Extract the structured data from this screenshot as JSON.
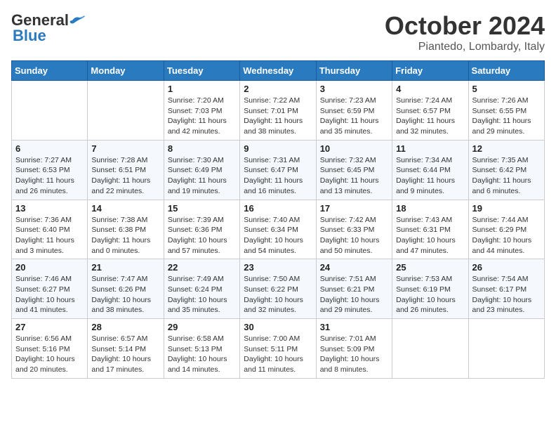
{
  "header": {
    "logo_general": "General",
    "logo_blue": "Blue",
    "title": "October 2024",
    "location": "Piantedo, Lombardy, Italy"
  },
  "days_of_week": [
    "Sunday",
    "Monday",
    "Tuesday",
    "Wednesday",
    "Thursday",
    "Friday",
    "Saturday"
  ],
  "weeks": [
    [
      {
        "day": "",
        "info": ""
      },
      {
        "day": "",
        "info": ""
      },
      {
        "day": "1",
        "info": "Sunrise: 7:20 AM\nSunset: 7:03 PM\nDaylight: 11 hours and 42 minutes."
      },
      {
        "day": "2",
        "info": "Sunrise: 7:22 AM\nSunset: 7:01 PM\nDaylight: 11 hours and 38 minutes."
      },
      {
        "day": "3",
        "info": "Sunrise: 7:23 AM\nSunset: 6:59 PM\nDaylight: 11 hours and 35 minutes."
      },
      {
        "day": "4",
        "info": "Sunrise: 7:24 AM\nSunset: 6:57 PM\nDaylight: 11 hours and 32 minutes."
      },
      {
        "day": "5",
        "info": "Sunrise: 7:26 AM\nSunset: 6:55 PM\nDaylight: 11 hours and 29 minutes."
      }
    ],
    [
      {
        "day": "6",
        "info": "Sunrise: 7:27 AM\nSunset: 6:53 PM\nDaylight: 11 hours and 26 minutes."
      },
      {
        "day": "7",
        "info": "Sunrise: 7:28 AM\nSunset: 6:51 PM\nDaylight: 11 hours and 22 minutes."
      },
      {
        "day": "8",
        "info": "Sunrise: 7:30 AM\nSunset: 6:49 PM\nDaylight: 11 hours and 19 minutes."
      },
      {
        "day": "9",
        "info": "Sunrise: 7:31 AM\nSunset: 6:47 PM\nDaylight: 11 hours and 16 minutes."
      },
      {
        "day": "10",
        "info": "Sunrise: 7:32 AM\nSunset: 6:45 PM\nDaylight: 11 hours and 13 minutes."
      },
      {
        "day": "11",
        "info": "Sunrise: 7:34 AM\nSunset: 6:44 PM\nDaylight: 11 hours and 9 minutes."
      },
      {
        "day": "12",
        "info": "Sunrise: 7:35 AM\nSunset: 6:42 PM\nDaylight: 11 hours and 6 minutes."
      }
    ],
    [
      {
        "day": "13",
        "info": "Sunrise: 7:36 AM\nSunset: 6:40 PM\nDaylight: 11 hours and 3 minutes."
      },
      {
        "day": "14",
        "info": "Sunrise: 7:38 AM\nSunset: 6:38 PM\nDaylight: 11 hours and 0 minutes."
      },
      {
        "day": "15",
        "info": "Sunrise: 7:39 AM\nSunset: 6:36 PM\nDaylight: 10 hours and 57 minutes."
      },
      {
        "day": "16",
        "info": "Sunrise: 7:40 AM\nSunset: 6:34 PM\nDaylight: 10 hours and 54 minutes."
      },
      {
        "day": "17",
        "info": "Sunrise: 7:42 AM\nSunset: 6:33 PM\nDaylight: 10 hours and 50 minutes."
      },
      {
        "day": "18",
        "info": "Sunrise: 7:43 AM\nSunset: 6:31 PM\nDaylight: 10 hours and 47 minutes."
      },
      {
        "day": "19",
        "info": "Sunrise: 7:44 AM\nSunset: 6:29 PM\nDaylight: 10 hours and 44 minutes."
      }
    ],
    [
      {
        "day": "20",
        "info": "Sunrise: 7:46 AM\nSunset: 6:27 PM\nDaylight: 10 hours and 41 minutes."
      },
      {
        "day": "21",
        "info": "Sunrise: 7:47 AM\nSunset: 6:26 PM\nDaylight: 10 hours and 38 minutes."
      },
      {
        "day": "22",
        "info": "Sunrise: 7:49 AM\nSunset: 6:24 PM\nDaylight: 10 hours and 35 minutes."
      },
      {
        "day": "23",
        "info": "Sunrise: 7:50 AM\nSunset: 6:22 PM\nDaylight: 10 hours and 32 minutes."
      },
      {
        "day": "24",
        "info": "Sunrise: 7:51 AM\nSunset: 6:21 PM\nDaylight: 10 hours and 29 minutes."
      },
      {
        "day": "25",
        "info": "Sunrise: 7:53 AM\nSunset: 6:19 PM\nDaylight: 10 hours and 26 minutes."
      },
      {
        "day": "26",
        "info": "Sunrise: 7:54 AM\nSunset: 6:17 PM\nDaylight: 10 hours and 23 minutes."
      }
    ],
    [
      {
        "day": "27",
        "info": "Sunrise: 6:56 AM\nSunset: 5:16 PM\nDaylight: 10 hours and 20 minutes."
      },
      {
        "day": "28",
        "info": "Sunrise: 6:57 AM\nSunset: 5:14 PM\nDaylight: 10 hours and 17 minutes."
      },
      {
        "day": "29",
        "info": "Sunrise: 6:58 AM\nSunset: 5:13 PM\nDaylight: 10 hours and 14 minutes."
      },
      {
        "day": "30",
        "info": "Sunrise: 7:00 AM\nSunset: 5:11 PM\nDaylight: 10 hours and 11 minutes."
      },
      {
        "day": "31",
        "info": "Sunrise: 7:01 AM\nSunset: 5:09 PM\nDaylight: 10 hours and 8 minutes."
      },
      {
        "day": "",
        "info": ""
      },
      {
        "day": "",
        "info": ""
      }
    ]
  ]
}
